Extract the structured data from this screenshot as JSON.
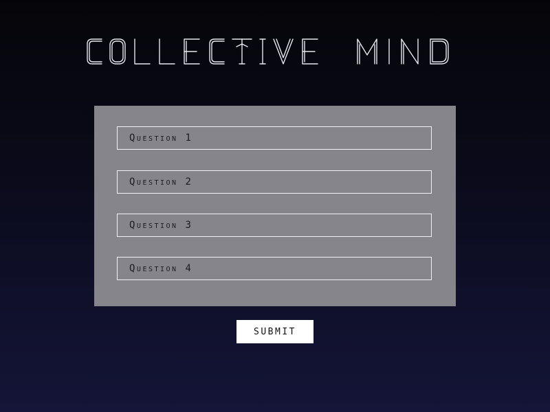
{
  "header": {
    "title": "COLLECTIVE MIND"
  },
  "form": {
    "questions": [
      {
        "placeholder": "Question 1",
        "value": ""
      },
      {
        "placeholder": "Question 2",
        "value": ""
      },
      {
        "placeholder": "Question 3",
        "value": ""
      },
      {
        "placeholder": "Question 4",
        "value": ""
      }
    ],
    "submit_label": "SUBMIT"
  },
  "colors": {
    "background_top": "#050509",
    "background_bottom": "#141538",
    "panel": "#86858b",
    "field_border": "#f2f2f5",
    "title_stroke": "#e8e8ee",
    "button_bg": "#ffffff"
  }
}
